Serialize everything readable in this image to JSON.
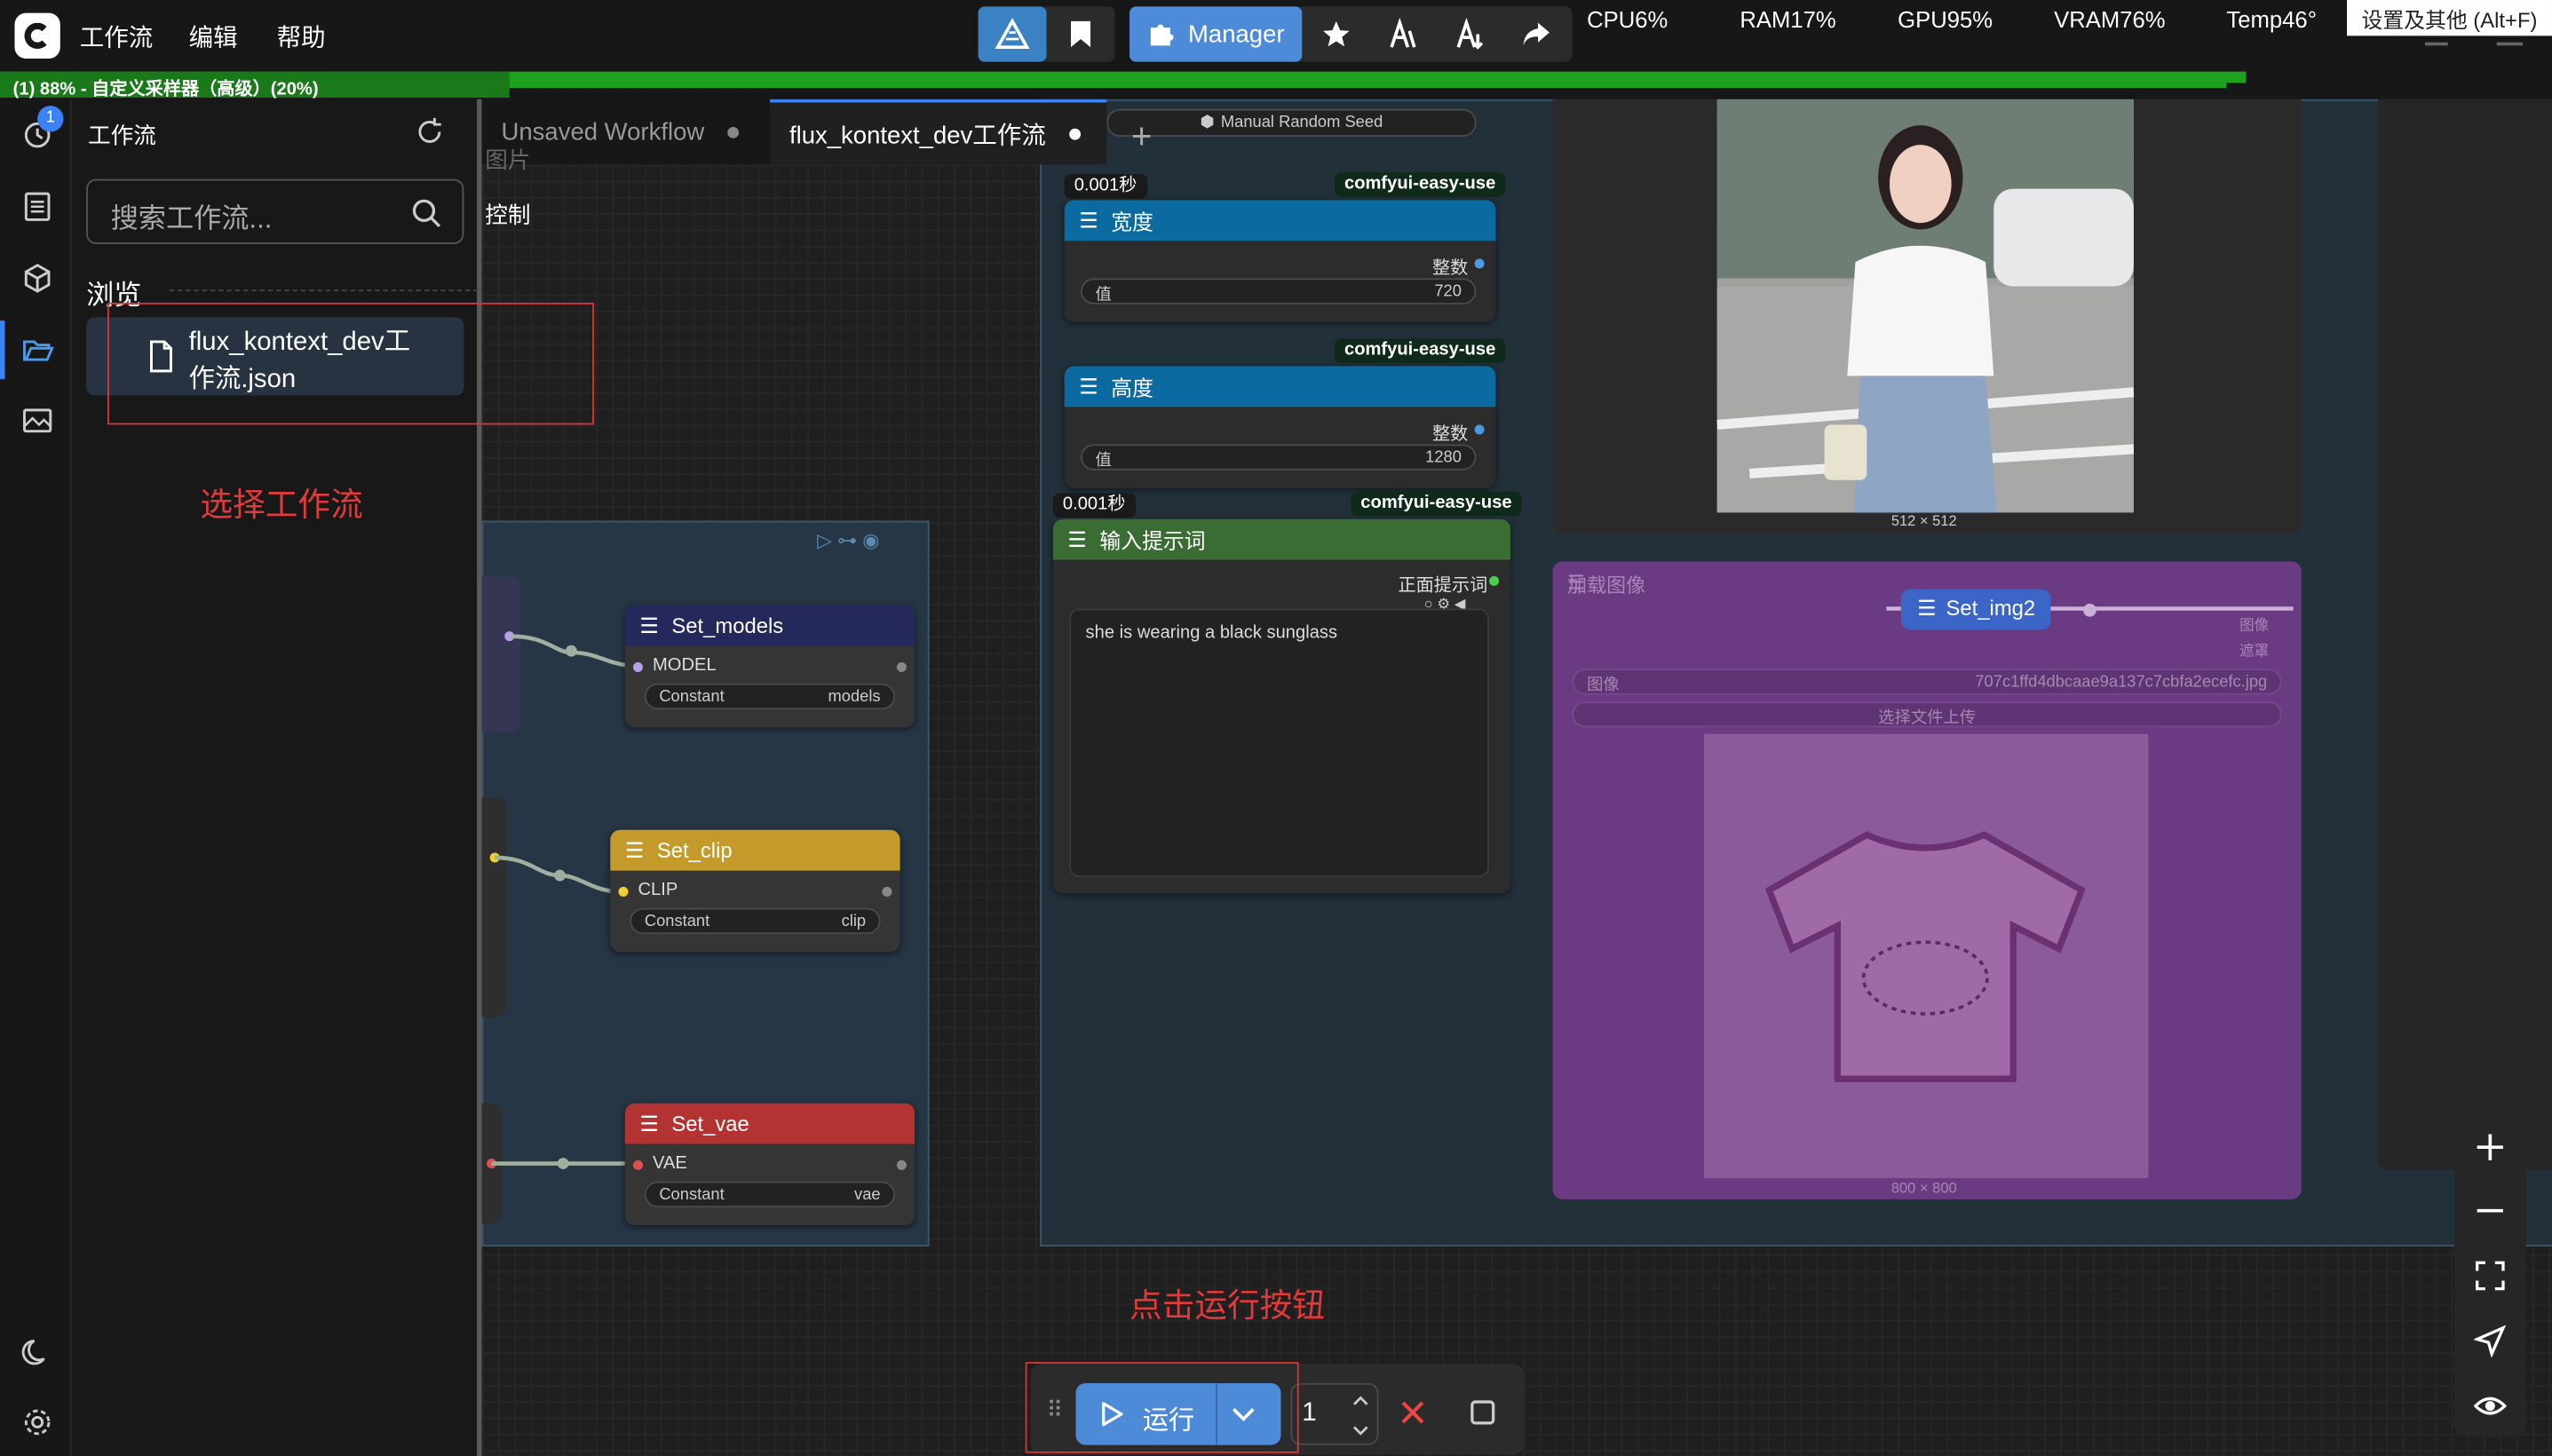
{
  "menu": {
    "workflow": "工作流",
    "edit": "编辑",
    "help": "帮助"
  },
  "toolbar": {
    "manager_label": "Manager",
    "tooltip": "设置及其他 (Alt+F)"
  },
  "stats": {
    "cpu": "CPU6%",
    "ram": "RAM17%",
    "gpu": "GPU95%",
    "vram": "VRAM76%",
    "temp": "Temp46°"
  },
  "progress": {
    "text": "(1) 88% - 自定义采样器（高级）(20%)",
    "fraction": 0.88
  },
  "sidebar": {
    "history_badge": "1"
  },
  "panel": {
    "title": "工作流",
    "search_placeholder": "搜索工作流...",
    "browse": "浏览",
    "file": "flux_kontext_dev工作流.json"
  },
  "tabs": [
    {
      "label": "Unsaved Workflow"
    },
    {
      "label": "flux_kontext_dev工作流"
    }
  ],
  "canvas": {
    "clip_text_1": "图片",
    "clip_text_2": "控制",
    "seed_label": "Manual Random Seed",
    "width_node": {
      "timer": "0.001秒",
      "tag": "comfyui-easy-use",
      "title": "宽度",
      "out": "整数",
      "param": "值",
      "value": "720"
    },
    "height_node": {
      "tag": "comfyui-easy-use",
      "title": "高度",
      "out": "整数",
      "param": "值",
      "value": "1280"
    },
    "prompt_node": {
      "timer": "0.001秒",
      "tag": "comfyui-easy-use",
      "title": "输入提示词",
      "out": "正面提示词",
      "text": "she is wearing a black sunglass"
    },
    "preview_size": "512 × 512",
    "load_image": {
      "title": "加载图像",
      "set_node": "Set_img2",
      "out1": "图像",
      "out2": "遮罩",
      "param": "图像",
      "file": "707c1ffd4dbcaae9a137c7cbfa2ecefc.jpg",
      "upload": "选择文件上传",
      "size": "800 × 800"
    },
    "set_models": {
      "title": "Set_models",
      "slot": "MODEL",
      "widget": "Constant",
      "value": "models"
    },
    "set_clip": {
      "title": "Set_clip",
      "slot": "CLIP",
      "widget": "Constant",
      "value": "clip"
    },
    "set_vae": {
      "title": "Set_vae",
      "slot": "VAE",
      "widget": "Constant",
      "value": "vae"
    }
  },
  "annotations": {
    "select": "选择工作流",
    "run": "点击运行按钮"
  },
  "runbar": {
    "run_label": "运行",
    "quantity": "1"
  },
  "colors": {
    "accent": "#4d8ad8",
    "progress": "#1ea11e",
    "annotation": "#e23a3a",
    "width_header": "#0b6aa0",
    "prompt_header": "#3a6d34",
    "clip_header": "#c49a2a",
    "vae_header": "#b33232",
    "models_header": "#2a2a5a",
    "load_group": "#6a3a82"
  }
}
